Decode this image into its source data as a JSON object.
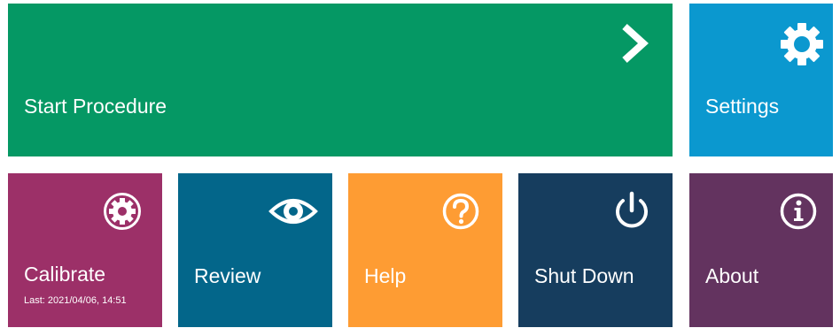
{
  "tiles": {
    "start_procedure": {
      "label": "Start Procedure",
      "icon": "chevron-right-icon",
      "color": "#059864"
    },
    "settings": {
      "label": "Settings",
      "icon": "gear-icon",
      "color": "#0B98CF"
    },
    "calibrate": {
      "label": "Calibrate",
      "sublabel": "Last: 2021/04/06, 14:51",
      "icon": "calibrate-gear-icon",
      "color": "#9C3068"
    },
    "review": {
      "label": "Review",
      "icon": "eye-icon",
      "color": "#03668A"
    },
    "help": {
      "label": "Help",
      "icon": "question-icon",
      "color": "#FE9C33"
    },
    "shut_down": {
      "label": "Shut Down",
      "icon": "power-icon",
      "color": "#163D5E"
    },
    "about": {
      "label": "About",
      "icon": "info-icon",
      "color": "#63335F"
    }
  }
}
